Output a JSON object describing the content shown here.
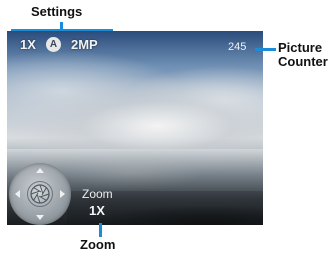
{
  "callouts": {
    "settings": "Settings",
    "counter_line1": "Picture",
    "counter_line2": "Counter",
    "zoom": "Zoom"
  },
  "hud": {
    "zoom_level": "1X",
    "auto_mode": "A",
    "resolution": "2MP",
    "picture_count": "245"
  },
  "zoom_control": {
    "label": "Zoom",
    "value": "1X"
  },
  "icons": {
    "shutter": "aperture-icon",
    "auto": "auto-mode-icon"
  },
  "colors": {
    "callout_line": "#1a8cd8"
  }
}
